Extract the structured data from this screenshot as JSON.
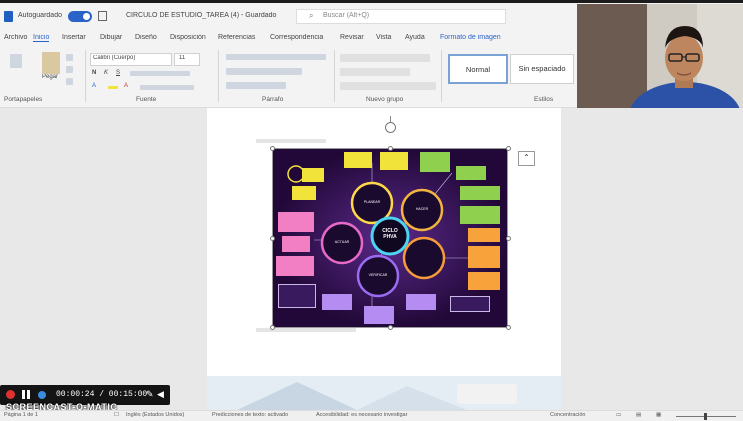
{
  "titlebar": {
    "autosave_label": "Autoguardado",
    "doc_title": "CIRCULO DE ESTUDIO_TAREA (4) - Guardado",
    "search_placeholder": "Buscar (Alt+Q)"
  },
  "menu": [
    "Archivo",
    "Inicio",
    "Insertar",
    "Dibujar",
    "Diseño",
    "Disposición",
    "Referencias",
    "Correspondencia",
    "Revisar",
    "Vista",
    "Ayuda",
    "Formato de imagen"
  ],
  "ribbon": {
    "groups": [
      "Portapapeles",
      "Fuente",
      "Párrafo",
      "Estilos"
    ],
    "font_name": "Calibri (Cuerpo)",
    "font_size": "11",
    "paste_label": "Pegar",
    "style_normal": "Normal",
    "style_no_spacing": "Sin espaciado"
  },
  "page": {
    "caption_top": "",
    "caption_bottom": "",
    "infographic_center": "CICLO PHVA",
    "infographic_phases": [
      "PLANEAR",
      "HACER",
      "VERIFICAR",
      "ACTUAR"
    ]
  },
  "recorder": {
    "time": "00:00:24 / 00:15:00",
    "brand": "SCREENCAST-O-MATIC"
  },
  "status": {
    "page": "Página 1 de 1",
    "words": "",
    "language": "Inglés (Estados Unidos)",
    "text_predictions": "Predicciones de texto: activado",
    "accessibility": "Accesibilidad: es necesario investigar",
    "focus": "Concentración"
  },
  "colors": {
    "accent": "#2a63c8",
    "infographic_bg": "#2b0d4a",
    "note_yellow": "#f2e33a",
    "note_green": "#8fd14f",
    "note_pink": "#f27fc4",
    "note_orange": "#f7a23a",
    "note_purple": "#b48cf2"
  }
}
